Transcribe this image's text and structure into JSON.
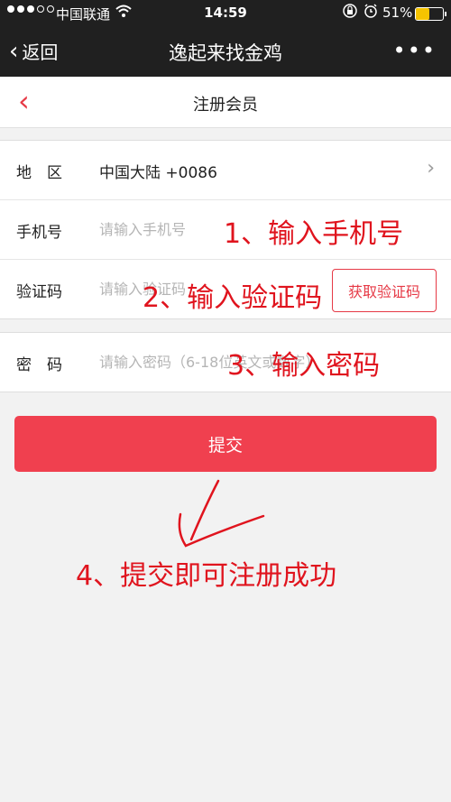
{
  "status_bar": {
    "carrier": "中国联通",
    "time": "14:59",
    "battery_percent": "51%",
    "battery_level": 0.51,
    "signal_bars_filled": 3,
    "icons": [
      "signal-dots-icon",
      "wifi-icon",
      "rotation-lock-icon",
      "alarm-icon",
      "battery-icon"
    ]
  },
  "nav": {
    "back_label": "返回",
    "title": "逸起来找金鸡",
    "more_icon": "ellipsis-icon"
  },
  "page": {
    "title": "注册会员",
    "back_icon": "chevron-left-icon"
  },
  "form": {
    "region": {
      "label": "地　区",
      "value": "中国大陆 +0086"
    },
    "phone": {
      "label": "手机号",
      "placeholder": "请输入手机号"
    },
    "code": {
      "label": "验证码",
      "placeholder": "请输入验证码",
      "button": "获取验证码"
    },
    "password": {
      "label": "密　码",
      "placeholder": "请输入密码（6-18位英文或数字）"
    },
    "submit": "提交"
  },
  "annotations": {
    "step1": "1、输入手机号",
    "step2": "2、输入验证码",
    "step3": "3、输入密码",
    "step4": "4、提交即可注册成功"
  },
  "colors": {
    "accent": "#e63946",
    "submit": "#f0404f",
    "annotation": "#e0141e",
    "bar_bg": "#202020"
  }
}
